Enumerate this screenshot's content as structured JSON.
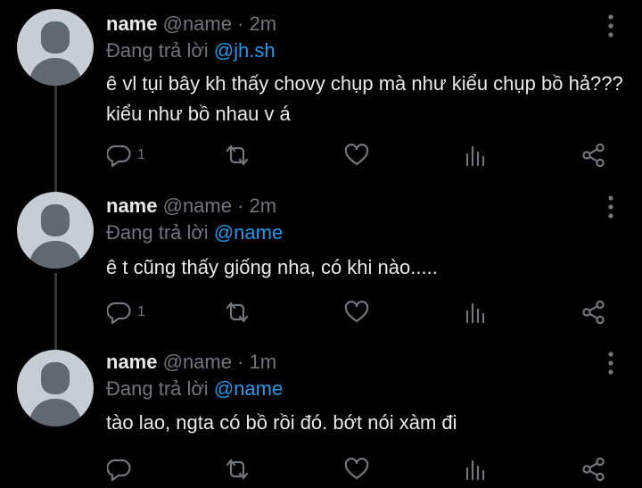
{
  "tweets": [
    {
      "display_name": "name",
      "handle": "@name",
      "separator": "·",
      "time": "2m",
      "reply_prefix": "Đang trả lời",
      "reply_to": "@jh.sh",
      "text": "ê vl tụi bây kh thấy chovy chụp mà như kiểu chụp bồ hả??? kiểu như bồ nhau v á",
      "reply_count": "1"
    },
    {
      "display_name": "name",
      "handle": "@name",
      "separator": "·",
      "time": "2m",
      "reply_prefix": "Đang trả lời",
      "reply_to": "@name",
      "text": "ê t cũng thấy giống nha, có khi nào.....",
      "reply_count": "1"
    },
    {
      "display_name": "name",
      "handle": "@name",
      "separator": "·",
      "time": "1m",
      "reply_prefix": "Đang trả lời",
      "reply_to": "@name",
      "text": "tào lao, ngta có bồ rồi đó. bớt nói xàm đi",
      "reply_count": ""
    }
  ],
  "colors": {
    "background": "#000000",
    "text_primary": "#e7e9ea",
    "text_secondary": "#71767b",
    "accent": "#1d9bf0",
    "thread_line": "#333639",
    "avatar_bg": "#c7cdd3",
    "avatar_figure": "#606870"
  },
  "icons": [
    "more-vertical-icon",
    "reply-icon",
    "retweet-icon",
    "like-icon",
    "analytics-icon",
    "share-icon"
  ]
}
